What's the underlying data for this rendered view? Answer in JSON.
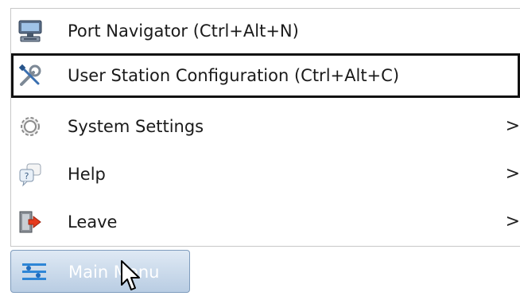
{
  "menu": {
    "items": [
      {
        "label": "Port Navigator (Ctrl+Alt+N)",
        "icon": "port-navigator-icon",
        "has_submenu": false,
        "selected": false
      },
      {
        "label": "User Station Configuration (Ctrl+Alt+C)",
        "icon": "wrench-screwdriver-icon",
        "has_submenu": false,
        "selected": true
      },
      {
        "label": "System Settings",
        "icon": "gear-icon",
        "has_submenu": true,
        "selected": false
      },
      {
        "label": "Help",
        "icon": "help-bubbles-icon",
        "has_submenu": true,
        "selected": false
      },
      {
        "label": "Leave",
        "icon": "exit-door-icon",
        "has_submenu": true,
        "selected": false
      }
    ],
    "chevron": ">"
  },
  "taskbar": {
    "main_menu_label": "Main Menu",
    "icon": "main-menu-icon"
  },
  "colors": {
    "selection_border": "#111111",
    "button_gradient_top": "#dfe9f4",
    "button_gradient_bottom": "#b9cde3",
    "button_text": "#ffffff"
  }
}
